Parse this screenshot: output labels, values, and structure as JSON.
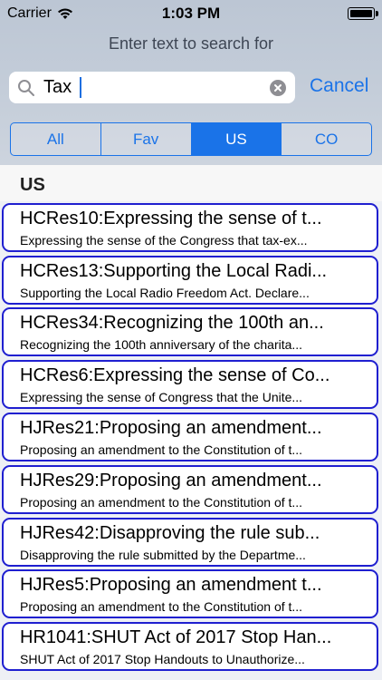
{
  "status_bar": {
    "carrier": "Carrier",
    "time": "1:03 PM",
    "icons": [
      "wifi-icon",
      "battery-icon"
    ]
  },
  "search": {
    "prompt": "Enter text to search for",
    "value": "Tax",
    "cancel_label": "Cancel",
    "icons": [
      "search-icon",
      "clear-icon"
    ]
  },
  "scope": {
    "segments": [
      "All",
      "Fav",
      "US",
      "CO"
    ],
    "selected": "US"
  },
  "section": {
    "title": "US"
  },
  "items": [
    {
      "title": "HCRes10:Expressing the sense of t...",
      "subtitle": "Expressing the sense of the Congress that tax-ex..."
    },
    {
      "title": "HCRes13:Supporting the Local Radi...",
      "subtitle": "Supporting the Local Radio Freedom Act. Declare..."
    },
    {
      "title": "HCRes34:Recognizing the 100th an...",
      "subtitle": "Recognizing the 100th anniversary of the charita..."
    },
    {
      "title": "HCRes6:Expressing the sense of Co...",
      "subtitle": "Expressing the sense of Congress that the Unite..."
    },
    {
      "title": "HJRes21:Proposing an amendment...",
      "subtitle": "Proposing an amendment to the Constitution of t..."
    },
    {
      "title": "HJRes29:Proposing an amendment...",
      "subtitle": "Proposing an amendment to the Constitution of t..."
    },
    {
      "title": "HJRes42:Disapproving the rule sub...",
      "subtitle": "Disapproving the rule submitted by the Departme..."
    },
    {
      "title": "HJRes5:Proposing an amendment t...",
      "subtitle": "Proposing an amendment to the Constitution of t..."
    },
    {
      "title": "HR1041:SHUT Act of 2017 Stop Han...",
      "subtitle": "SHUT Act of 2017 Stop Handouts to Unauthorize..."
    }
  ],
  "colors": {
    "accent": "#1a73e8",
    "item_border": "#1f1fd0"
  }
}
